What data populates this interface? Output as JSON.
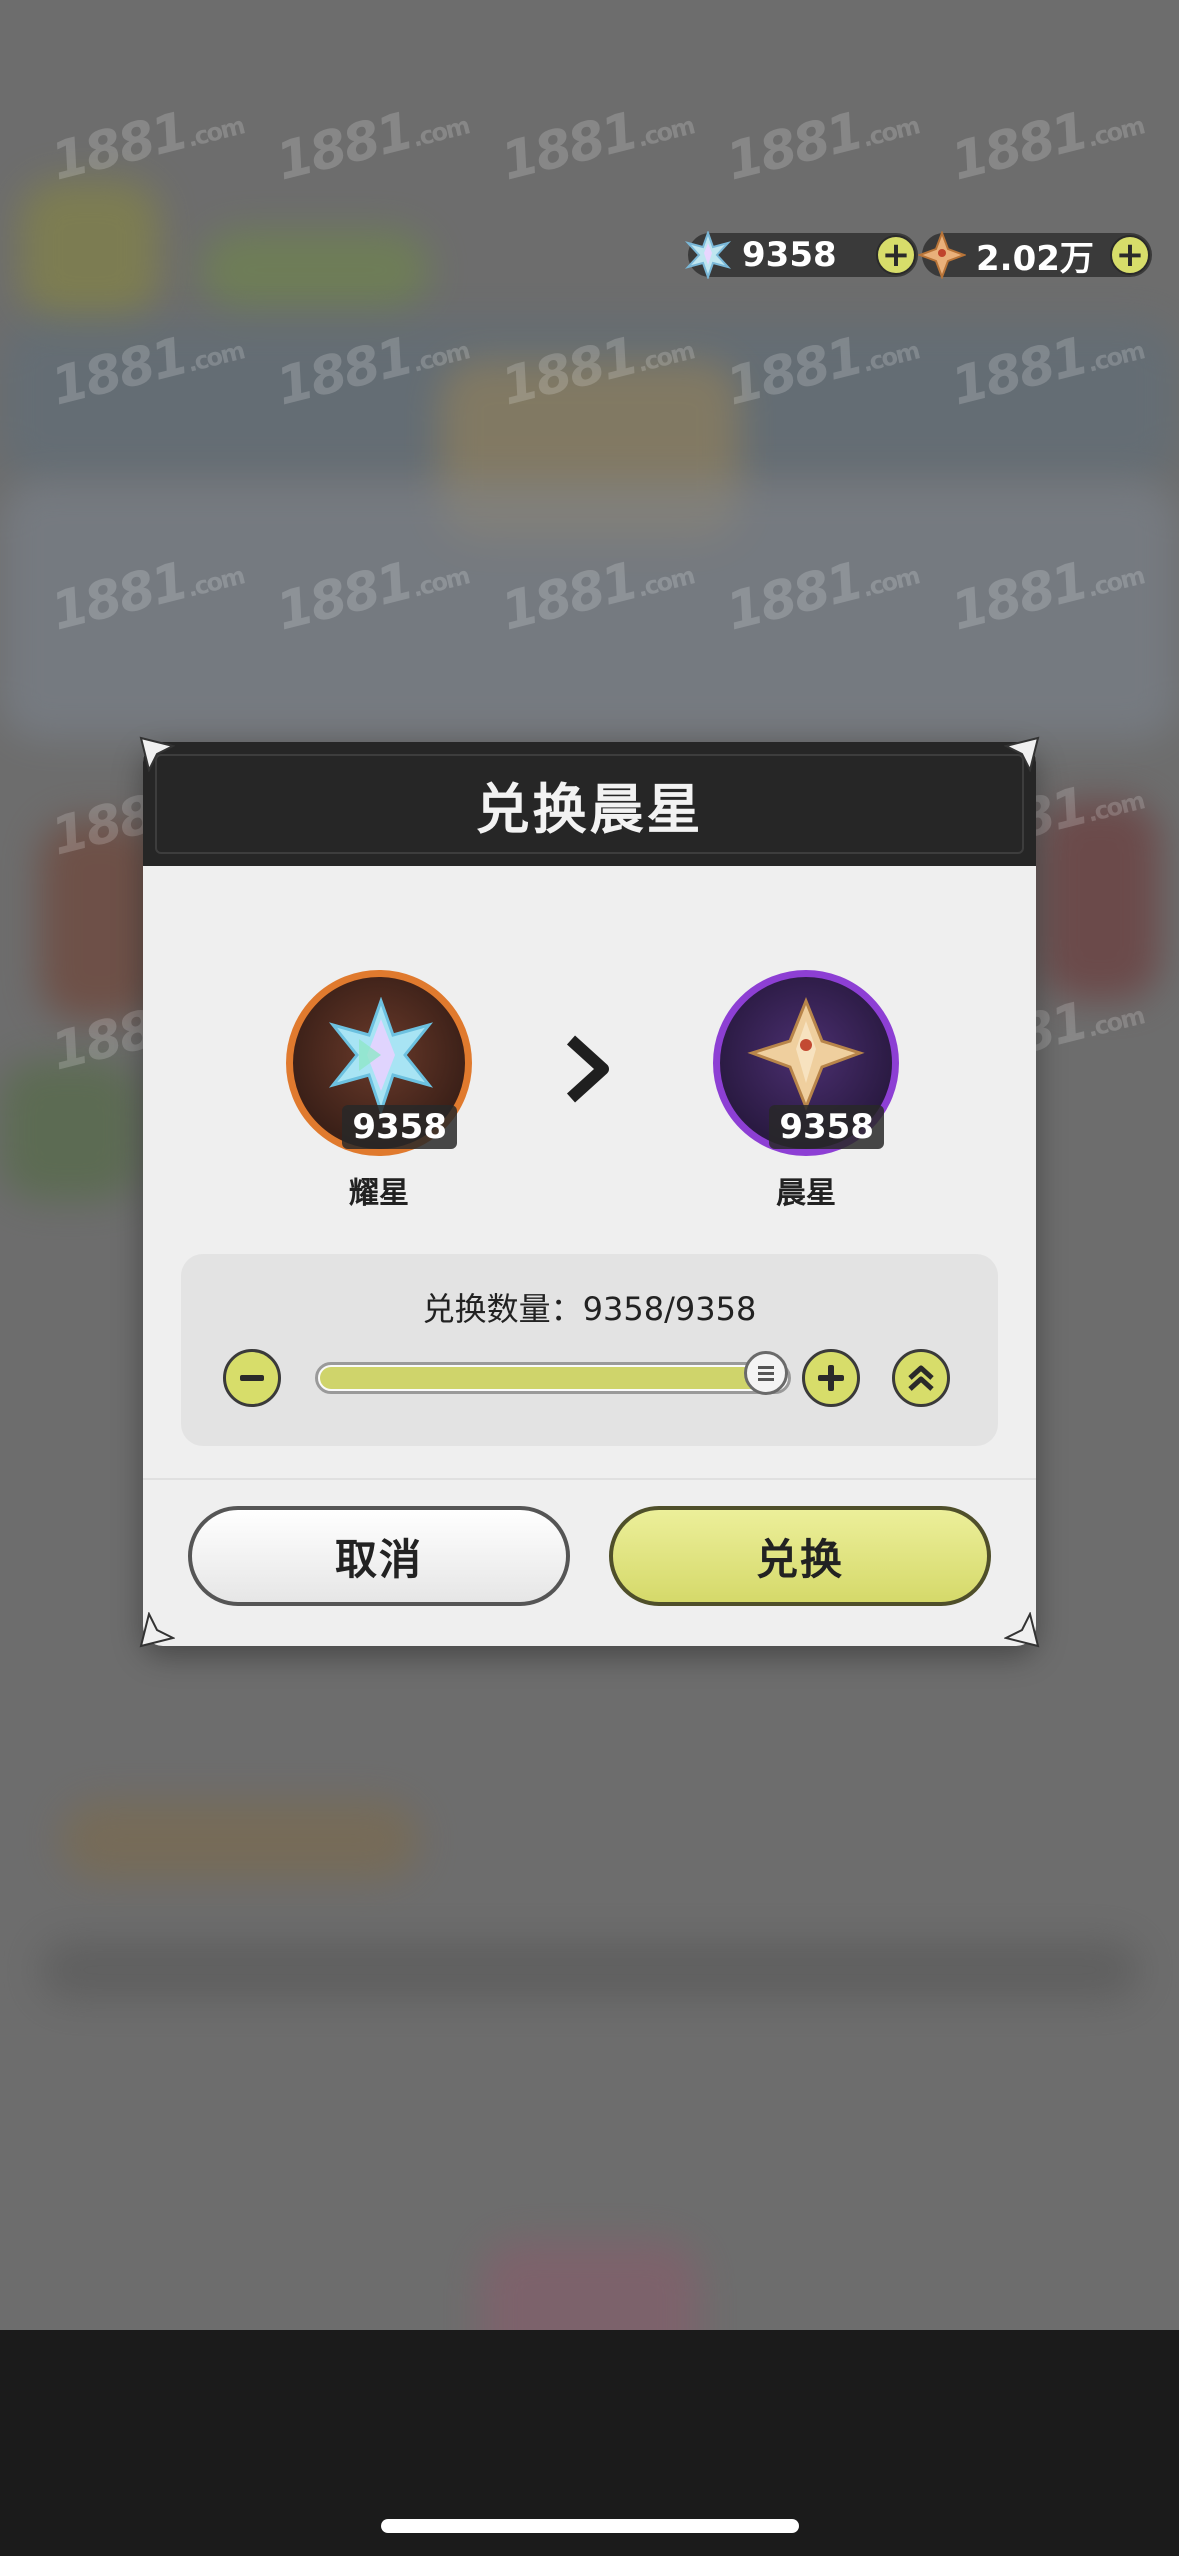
{
  "currency_bar": {
    "stars": {
      "icon": "star-crystal-icon",
      "amount": "9358"
    },
    "dawnstars": {
      "icon": "dawn-star-icon",
      "amount": "2.02万"
    }
  },
  "watermark_text": "1881",
  "watermark_suffix": ".com",
  "dialog": {
    "title": "兑换晨星",
    "source": {
      "name": "耀星",
      "count": "9358",
      "icon": "star-crystal-icon"
    },
    "target": {
      "name": "晨星",
      "count": "9358",
      "icon": "dawn-star-icon"
    },
    "arrow_icon": "chevron-right-icon",
    "quantity_label": "兑换数量：9358/9358",
    "quantity_value": 9358,
    "quantity_max": 9358,
    "slider_fraction": 1.0,
    "cancel_label": "取消",
    "confirm_label": "兑换"
  },
  "colors": {
    "accent": "#d7dd6a",
    "header_bg": "#262626",
    "source_ring": "#e07a2e",
    "target_ring": "#8d3fd4"
  }
}
